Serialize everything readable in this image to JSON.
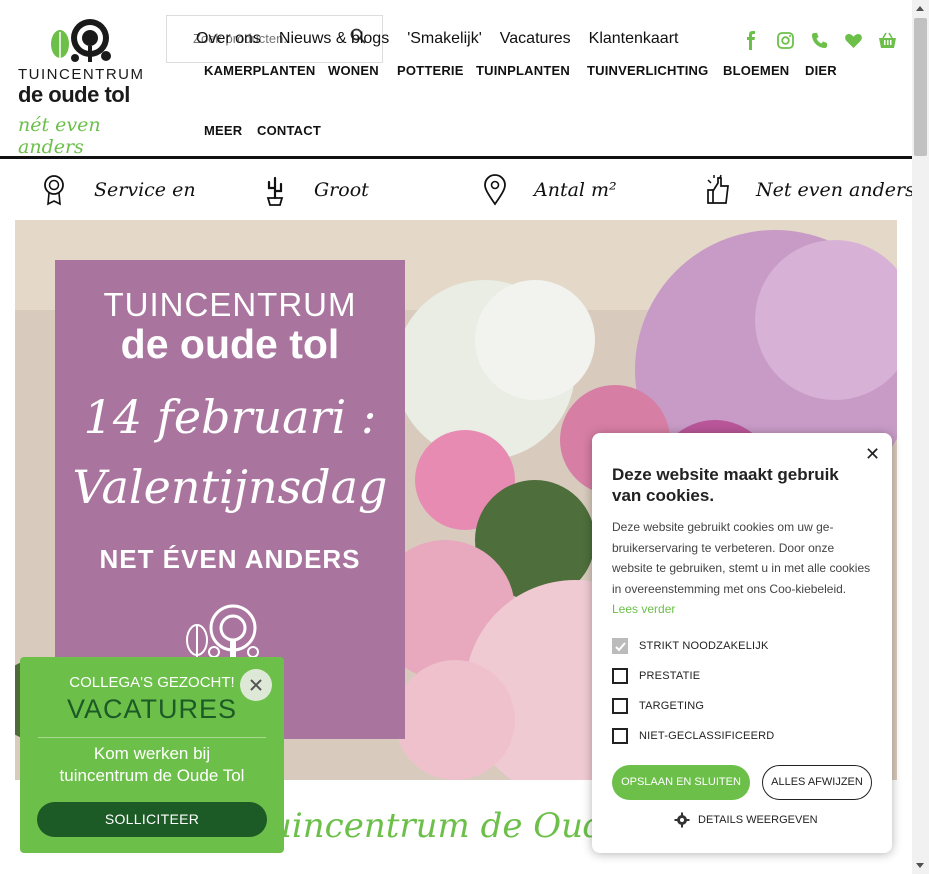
{
  "header": {
    "logo": {
      "line1": "TUINCENTRUM",
      "line2": "de oude tol",
      "tagline": "nét even anders"
    },
    "search": {
      "placeholder": "Zoek producten..."
    },
    "topnav": [
      "Over ons",
      "Nieuws & blogs",
      "'Smakelijk'",
      "Vacatures",
      "Klantenkaart"
    ],
    "social_icons": [
      "facebook-icon",
      "instagram-icon",
      "phone-icon",
      "heart-icon",
      "basket-icon"
    ],
    "mainnav": [
      "KAMERPLANTEN",
      "WONEN",
      "POTTERIE",
      "TUINPLANTEN",
      "TUINVERLICHTING",
      "BLOEMEN",
      "DIER",
      "MEER",
      "CONTACT"
    ]
  },
  "usps": [
    {
      "icon": "award-icon",
      "label": "Service en"
    },
    {
      "icon": "cactus-icon",
      "label": "Groot"
    },
    {
      "icon": "location-pin-icon",
      "label": "Antal m²"
    },
    {
      "icon": "thumbs-up-icon",
      "label": "Net even anders"
    }
  ],
  "hero": {
    "line1": "TUINCENTRUM",
    "line2": "de oude tol",
    "line3": "14 februari :",
    "line4": "Valentijnsdag",
    "line5": "NET ÉVEN ANDERS"
  },
  "welcome_heading": "uincentrum de Oude Tol",
  "vacatures_popup": {
    "eyebrow": "COLLEGA'S GEZOCHT!",
    "title": "VACATURES",
    "body_line1": "Kom werken bij",
    "body_line2": "tuincentrum de Oude Tol",
    "button": "SOLLICITEER"
  },
  "cookie_popup": {
    "close": "✕",
    "title": "Deze website maakt gebruik van cookies.",
    "body": "Deze website gebruikt cookies om uw ge-bruikerservaring te verbeteren. Door onze website te gebruiken, stemt u in met alle cookies in overeenstemming met ons Coo-kiebeleid.",
    "read_more": "Lees verder",
    "options": [
      {
        "label": "STRIKT NOODZAKELIJK",
        "checked": true
      },
      {
        "label": "PRESTATIE",
        "checked": false
      },
      {
        "label": "TARGETING",
        "checked": false
      },
      {
        "label": "NIET-GECLASSIFICEERD",
        "checked": false
      }
    ],
    "save_button": "OPSLAAN EN SLUITEN",
    "reject_button": "ALLES AFWIJZEN",
    "details": "DETAILS WEERGEVEN"
  },
  "colors": {
    "brand_green": "#6cc04a",
    "dark_green": "#1c5a26",
    "hero_purple": "#a9759f"
  }
}
